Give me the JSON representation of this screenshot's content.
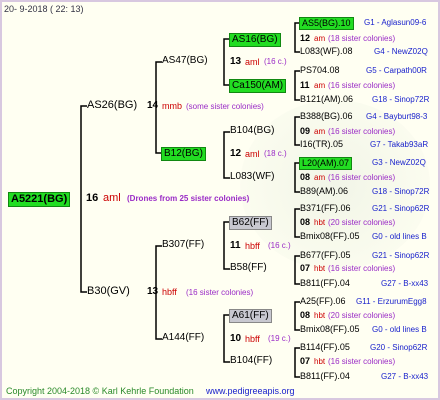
{
  "header": "20-  9-2018 ( 22: 13)",
  "root": {
    "id": "A5221(BG)",
    "gen": "16",
    "type": "aml",
    "note": "(Drones from 25 sister colonies)"
  },
  "g1": [
    {
      "id": "AS26(BG)",
      "gen": "14",
      "type": "mmb",
      "note": "(some sister colonies)"
    },
    {
      "id": "B30(GV)",
      "gen": "13",
      "type": "hbff",
      "note": "(16 sister colonies)"
    }
  ],
  "g2": [
    {
      "id": "AS47(BG)",
      "gen": "13",
      "type": "aml",
      "note": "(16 c.)"
    },
    {
      "id": "B12(BG)",
      "gen": "12",
      "type": "aml",
      "note": "(18 c.)"
    },
    {
      "id": "B307(FF)",
      "gen": "11",
      "type": "hbff",
      "note": "(16 c.)"
    },
    {
      "id": "A144(FF)",
      "gen": "10",
      "type": "hbff",
      "note": "(19 c.)"
    }
  ],
  "g3": [
    {
      "id": "AS16(BG)",
      "gen": "12",
      "type": "am",
      "note": "(18 sister colonies)"
    },
    {
      "id": "Ca150(AM)",
      "gen": "11",
      "type": "am",
      "note": "(16 sister colonies)"
    },
    {
      "id": "B104(BG)",
      "gen": "09",
      "type": "am",
      "note": "(16 sister colonies)"
    },
    {
      "id": "L083(WF)",
      "gen": "08",
      "type": "am",
      "note": "(16 sister colonies)"
    },
    {
      "id": "B62(FF)",
      "gen": "08",
      "type": "hbt",
      "note": "(20 sister colonies)"
    },
    {
      "id": "B58(FF)",
      "gen": "07",
      "type": "hbt",
      "note": "(16 sister colonies)"
    },
    {
      "id": "A61(FF)",
      "gen": "08",
      "type": "hbt",
      "note": "(20 sister colonies)"
    },
    {
      "id": "B104(FF)",
      "gen": "07",
      "type": "hbt",
      "note": "(16 sister colonies)"
    }
  ],
  "g4": [
    {
      "left": "AS5(BG).10",
      "right": "G1 - Aglasun09-6"
    },
    {
      "left": "L083(WF).08",
      "right": "G4 - NewZ02Q"
    },
    {
      "left": "PS704.08",
      "right": "G5 - Carpath00R"
    },
    {
      "left": "B121(AM).06",
      "right": "G18 - Sinop72R"
    },
    {
      "left": "B388(BG).06",
      "right": "G4 - Bayburt98-3"
    },
    {
      "left": "I16(TR).05",
      "right": "G7 - Takab93aR"
    },
    {
      "left": "L20(AM).07",
      "right": "G3 - NewZ02Q"
    },
    {
      "left": "B89(AM).06",
      "right": "G18 - Sinop72R"
    },
    {
      "left": "B371(FF).06",
      "right": "G21 - Sinop62R"
    },
    {
      "left": "Bmix08(FF).05",
      "right": "G0 - old lines B"
    },
    {
      "left": "B677(FF).05",
      "right": "G21 - Sinop62R"
    },
    {
      "left": "B811(FF).04",
      "right": "G27 - B-xx43"
    },
    {
      "left": "A25(FF).06",
      "right": "G11 - ErzurumEgg8"
    },
    {
      "left": "Bmix08(FF).05",
      "right": "G0 - old lines B"
    },
    {
      "left": "B114(FF).05",
      "right": "G20 - Sinop62R"
    },
    {
      "left": "B811(FF).04",
      "right": "G27 - B-xx43"
    }
  ],
  "footer": {
    "copyright": "Copyright 2004-2018 © Karl Kehrle Foundation",
    "site": "www.pedigreeapis.org"
  }
}
